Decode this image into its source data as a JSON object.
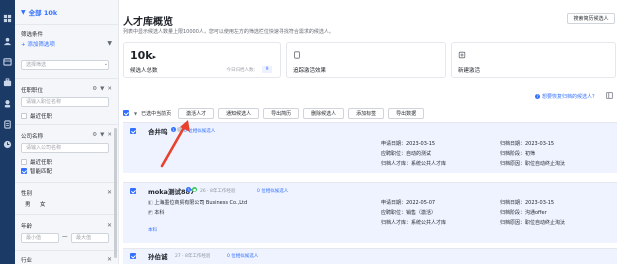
{
  "rail": {
    "icons": [
      "dashboard-icon",
      "people-icon",
      "calendar-icon",
      "briefcase-icon",
      "person-icon",
      "document-icon",
      "clock-icon"
    ]
  },
  "filter": {
    "scope_label": "全部 10k",
    "conditions_label": "筛选条件",
    "add_condition": "+ 添加筛选项",
    "select_placeholder": "选择筛选",
    "job_title": {
      "label": "任职职位",
      "placeholder": "请输入职位名称",
      "recent_label": "最近任职"
    },
    "company": {
      "label": "公司名称",
      "placeholder": "请输入公司名称",
      "recent_label": "最近任职",
      "smart_match": "智能匹配"
    },
    "gender": {
      "label": "性别",
      "options": [
        "男",
        "女"
      ]
    },
    "age": {
      "label": "年龄",
      "min_placeholder": "最小值",
      "separator": "—",
      "max_placeholder": "最大值"
    },
    "industry": {
      "label": "行业"
    }
  },
  "main": {
    "title": "人才库概览",
    "subtitle": "列表中显示候选人数量上限10000人，您可以使用左方的筛选栏位快速寻找符合需求的候选人。",
    "search_button": "搜索简历候选人",
    "cards": [
      {
        "value": "10k",
        "label": "候选人总数",
        "note": "今日归档人数：",
        "badge": "9"
      },
      {
        "label": "追踪激活效果"
      },
      {
        "label": "新建激活"
      }
    ],
    "help_link": "想要恢复归档的候选人？",
    "toolbar": {
      "selected_text": "已选中当前页",
      "buttons": [
        "激活人才",
        "通知候选人",
        "导出简历",
        "删除候选人",
        "添加标签",
        "导出数据"
      ]
    },
    "candidates": [
      {
        "name": "合井呜",
        "invite": "0 位相似候选人",
        "apply_time": "申请日期：2023-03-15",
        "apply_stage": "应聘职位：自动的测试",
        "archive_reason": "归档人才库：系统公共人才库",
        "archive_time": "归档日期：2023-03-15",
        "archive_stage": "归档阶段：初筛",
        "archive_cause": "归档原因：职位自动终止淘汰"
      },
      {
        "name": "moka测试887",
        "meta": "26 · 8年工作经验",
        "invite": "0 位相似候选人",
        "company": "上海墨位商贸有限公司 Business Co.,Ltd",
        "degree": "本科",
        "tag": "本科",
        "apply_time": "申请日期：2022-05-07",
        "apply_stage": "应聘职位：销售（激活）",
        "archive_reason": "归档人才库：系统公共人才库",
        "archive_time": "归档日期：2023-03-15",
        "archive_stage": "归档阶段：沟通offer",
        "archive_cause": "归档原因：职位自动终止淘汰"
      },
      {
        "name": "孙伯诚",
        "meta": "27 · 8年工作经验",
        "invite": "0 位相似候选人"
      }
    ]
  },
  "colors": {
    "accent": "#3370ff",
    "rail": "#1b3a66",
    "arrow": "#e8412c"
  }
}
